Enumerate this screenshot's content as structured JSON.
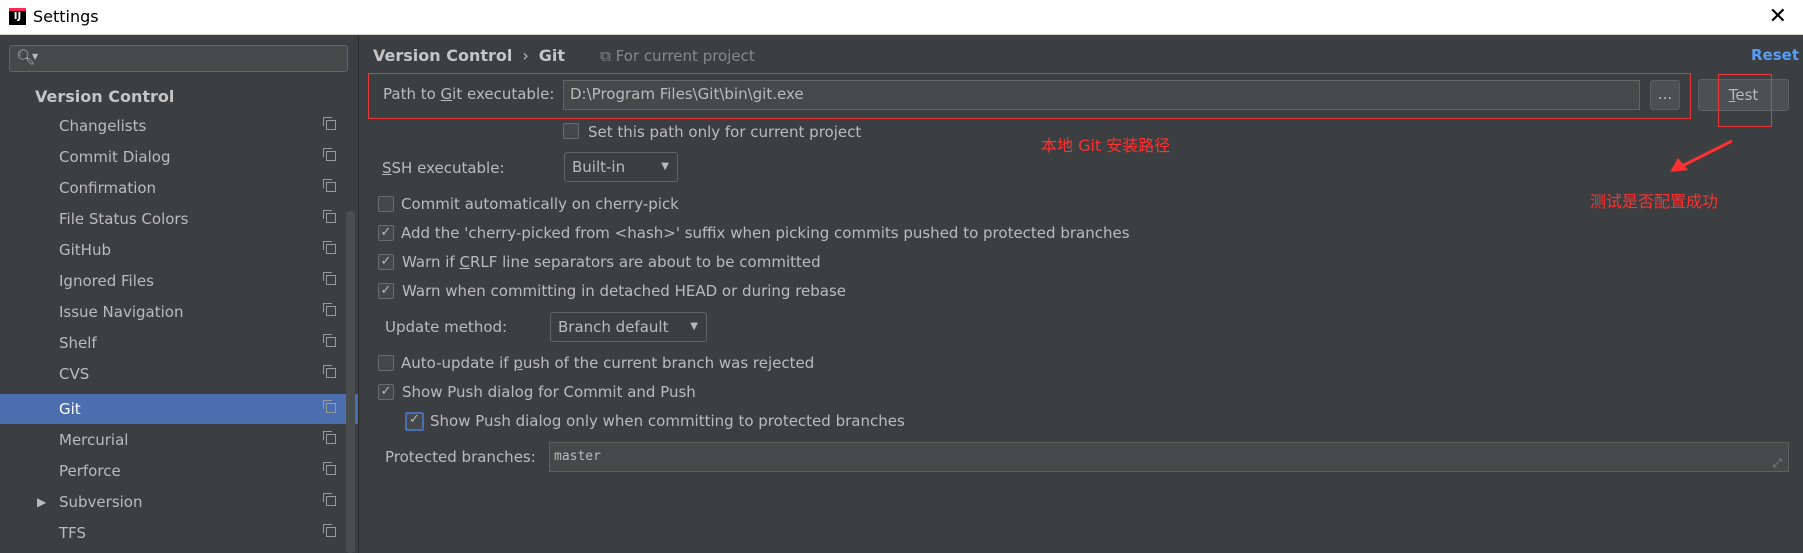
{
  "window": {
    "title": "Settings",
    "icon_text": "IJ"
  },
  "sidebar": {
    "search_placeholder": "",
    "header": "Version Control",
    "items": [
      {
        "label": "Changelists"
      },
      {
        "label": "Commit Dialog"
      },
      {
        "label": "Confirmation"
      },
      {
        "label": "File Status Colors"
      },
      {
        "label": "GitHub"
      },
      {
        "label": "Ignored Files"
      },
      {
        "label": "Issue Navigation"
      },
      {
        "label": "Shelf"
      },
      {
        "label": "CVS"
      },
      {
        "label": "Git",
        "selected": true
      },
      {
        "label": "Mercurial"
      },
      {
        "label": "Perforce"
      },
      {
        "label": "Subversion",
        "expandable": true
      },
      {
        "label": "TFS"
      }
    ]
  },
  "breadcrumb": {
    "part1": "Version Control",
    "sep": "›",
    "part2": "Git",
    "project_scope": "For current project"
  },
  "reset_label": "Reset",
  "git_path": {
    "label_pre": "Path to ",
    "label_u": "G",
    "label_post": "it executable:",
    "value": "D:\\Program Files\\Git\\bin\\git.exe",
    "browse_label": "...",
    "test_u": "T",
    "test_rest": "est"
  },
  "path_only_current": {
    "label": "Set this path only for current project",
    "checked": false
  },
  "ssh": {
    "label_u": "S",
    "label_rest": "SH executable:",
    "value": "Built-in"
  },
  "checkboxes": {
    "cherry_pick": {
      "label": "Commit automatically on cherry-pick",
      "checked": false
    },
    "cherry_suffix": {
      "label": "Add the 'cherry-picked from <hash>' suffix when picking commits pushed to protected branches",
      "checked": true
    },
    "crlf": {
      "label_pre": "Warn if ",
      "label_u": "C",
      "label_post": "RLF line separators are about to be committed",
      "checked": true
    },
    "detached": {
      "label": "Warn when committing in detached HEAD or during rebase",
      "checked": true
    },
    "auto_update": {
      "label_pre": "Auto-update if ",
      "label_u": "p",
      "label_post": "ush of the current branch was rejected",
      "checked": false
    },
    "push_dialog": {
      "label": "Show Push dialog for Commit and Push",
      "checked": true
    },
    "push_protected": {
      "label": "Show Push dialog only when committing to protected branches",
      "checked": true
    }
  },
  "update_method": {
    "label": "Update method:",
    "value": "Branch default"
  },
  "protected_branches": {
    "label": "Protected branches:",
    "value": "master"
  },
  "annotations": {
    "git_path_note": "本地 Git 安装路径",
    "test_note": "测试是否配置成功"
  },
  "colors": {
    "background": "#3c3f41",
    "selection": "#4b6eaf",
    "link": "#589df6",
    "annotation": "#ff3030"
  }
}
